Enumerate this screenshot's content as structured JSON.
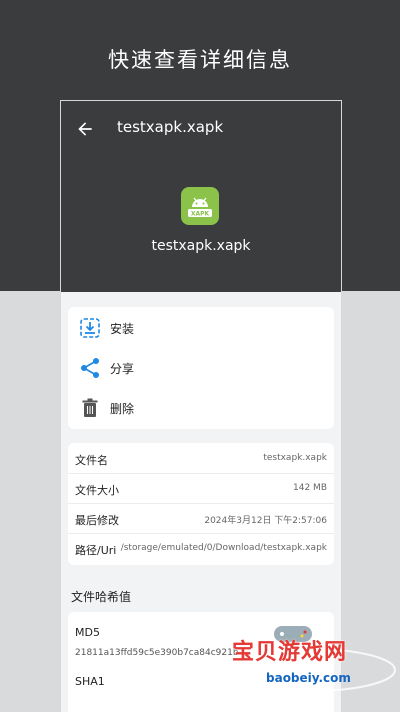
{
  "headline": "快速查看详细信息",
  "appbar": {
    "title": "testxapk.xapk",
    "file_name": "testxapk.xapk",
    "icon_label": "XAPK"
  },
  "actions": [
    {
      "label": "安装",
      "icon": "install-icon"
    },
    {
      "label": "分享",
      "icon": "share-icon"
    },
    {
      "label": "删除",
      "icon": "trash-icon"
    }
  ],
  "info": [
    {
      "key": "文件名",
      "value": "testxapk.xapk"
    },
    {
      "key": "文件大小",
      "value": "142 MB"
    },
    {
      "key": "最后修改",
      "value": "2024年3月12日 下午2:57:06"
    },
    {
      "key": "路径/Uri",
      "value": "/storage/emulated/0/Download/testxapk.xapk"
    }
  ],
  "hash_section": "文件哈希值",
  "hashes": [
    {
      "name": "MD5",
      "value": "21811a13ffd59c5e390b7ca84c921b"
    },
    {
      "name": "SHA1",
      "value": ""
    }
  ],
  "watermark": {
    "text": "宝贝游戏网",
    "url": "baobeiy.com"
  },
  "colors": {
    "accent": "#1e88e5",
    "app_green": "#8bc34a",
    "dark_bg": "#3a3c3e"
  }
}
